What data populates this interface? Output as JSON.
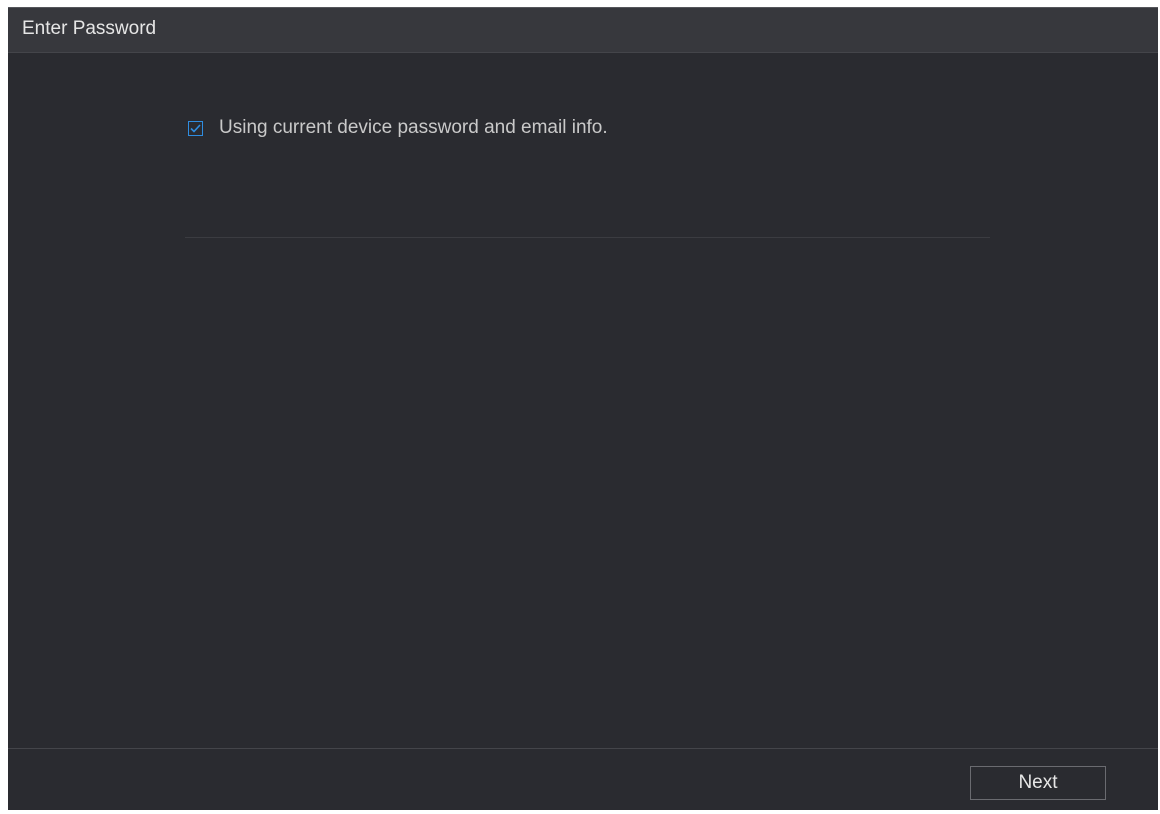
{
  "dialog": {
    "title": "Enter Password"
  },
  "options": {
    "use_current_info": {
      "label": "Using current device password and email info.",
      "checked": true,
      "check_icon": "checkmark-icon",
      "accent_color": "#2f8de0"
    }
  },
  "footer": {
    "next_label": "Next"
  }
}
